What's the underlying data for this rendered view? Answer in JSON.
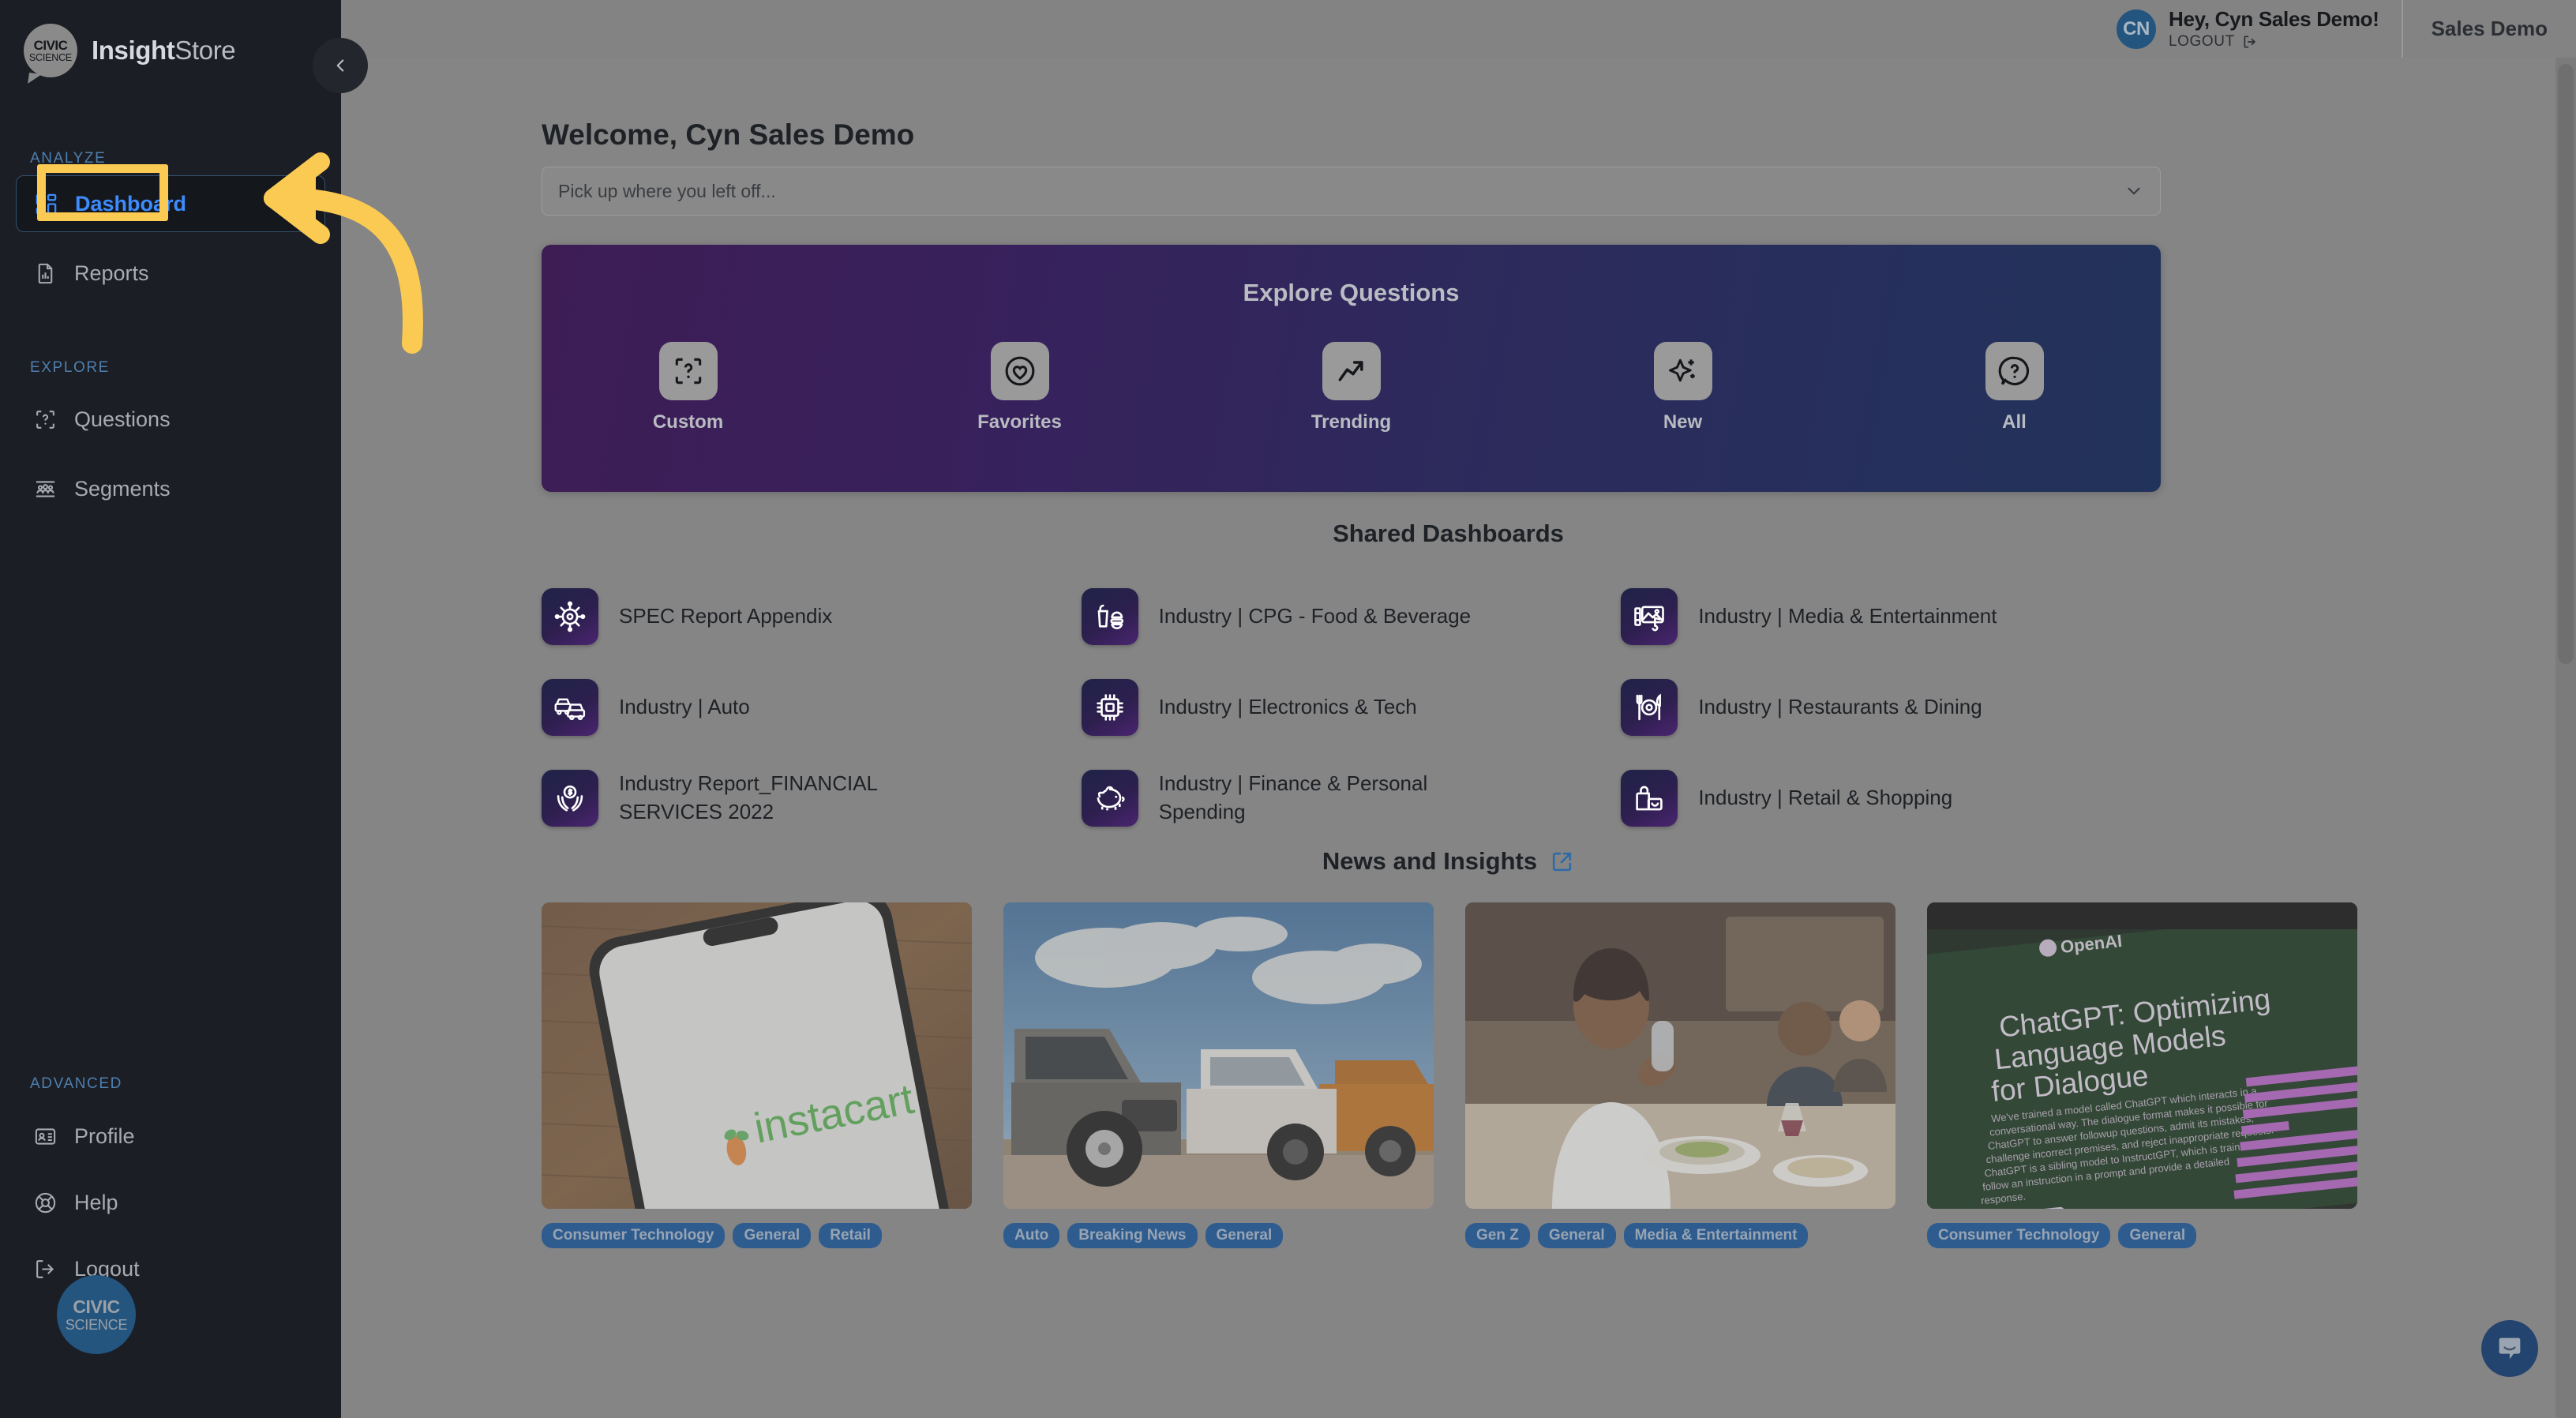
{
  "brand": {
    "logo_line1": "CIVIC",
    "logo_line2": "SCIENCE",
    "title_bold": "Insight",
    "title_light": "Store",
    "collapse_icon": "chevron-left-icon",
    "badge_line1": "CIVIC",
    "badge_line2": "SCIENCE"
  },
  "sidebar": {
    "sections": [
      {
        "label": "ANALYZE",
        "items": [
          {
            "label": "Dashboard",
            "icon": "dashboard-icon",
            "active": true
          },
          {
            "label": "Reports",
            "icon": "report-document-icon",
            "active": false
          }
        ]
      },
      {
        "label": "EXPLORE",
        "items": [
          {
            "label": "Questions",
            "icon": "question-box-icon",
            "active": false
          },
          {
            "label": "Segments",
            "icon": "segments-people-icon",
            "active": false
          }
        ]
      },
      {
        "label": "ADVANCED",
        "items": [
          {
            "label": "Profile",
            "icon": "id-card-icon",
            "active": false
          },
          {
            "label": "Help",
            "icon": "life-ring-icon",
            "active": false
          },
          {
            "label": "Logout",
            "icon": "logout-arrow-icon",
            "active": false
          }
        ]
      }
    ]
  },
  "topbar": {
    "avatar_initials": "CN",
    "greeting": "Hey, Cyn Sales Demo!",
    "logout_label": "LOGOUT",
    "logout_icon": "logout-arrow-icon",
    "org_name": "Sales Demo"
  },
  "main": {
    "welcome": "Welcome, Cyn Sales Demo",
    "pickup_placeholder": "Pick up where you left off...",
    "pickup_chevron": "chevron-down-icon"
  },
  "explore": {
    "title": "Explore Questions",
    "items": [
      {
        "label": "Custom",
        "icon": "question-box-icon"
      },
      {
        "label": "Favorites",
        "icon": "heart-icon"
      },
      {
        "label": "Trending",
        "icon": "trend-up-icon"
      },
      {
        "label": "New",
        "icon": "sparkle-icon"
      },
      {
        "label": "All",
        "icon": "question-chat-icon"
      }
    ]
  },
  "shared_dashboards": {
    "title": "Shared Dashboards",
    "items": [
      {
        "label": "SPEC Report Appendix",
        "icon": "virus-gear-icon"
      },
      {
        "label": "Industry | CPG - Food & Beverage",
        "icon": "food-drink-icon"
      },
      {
        "label": "Industry | Media & Entertainment",
        "icon": "media-photo-music-icon"
      },
      {
        "label": "Industry | Auto",
        "icon": "car-icon"
      },
      {
        "label": "Industry | Electronics & Tech",
        "icon": "cpu-chip-icon"
      },
      {
        "label": "Industry | Restaurants & Dining",
        "icon": "cutlery-plate-icon"
      },
      {
        "label": "Industry Report_FINANCIAL SERVICES 2022",
        "icon": "money-hands-icon"
      },
      {
        "label": "Industry | Finance & Personal Spending",
        "icon": "piggy-bank-icon"
      },
      {
        "label": "Industry | Retail & Shopping",
        "icon": "shopping-bag-icon"
      }
    ]
  },
  "news": {
    "title": "News and Insights",
    "external_icon": "external-link-icon",
    "cards": [
      {
        "image_alt": "instacart-phone-photo",
        "tags": [
          "Consumer Technology",
          "General",
          "Retail"
        ]
      },
      {
        "image_alt": "pickup-trucks-lot-photo",
        "tags": [
          "Auto",
          "Breaking News",
          "General"
        ]
      },
      {
        "image_alt": "woman-dining-restaurant-photo",
        "tags": [
          "Gen Z",
          "General",
          "Media & Entertainment"
        ]
      },
      {
        "image_alt": "chatgpt-openai-screen-photo",
        "tags": [
          "Consumer Technology",
          "General"
        ]
      }
    ]
  },
  "chat": {
    "icon": "chat-bubble-smile-icon"
  },
  "colors": {
    "sidebar_bg": "#1b1e24",
    "accent_blue": "#3d8bfd",
    "annotation_yellow": "#fbca52",
    "tag_blue": "#2f5c8f",
    "banner_purple": "#3e1d55",
    "banner_navy": "#22335b"
  }
}
